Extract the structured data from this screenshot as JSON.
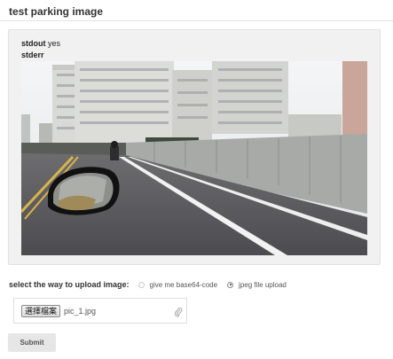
{
  "page": {
    "title": "test parking image"
  },
  "output": {
    "stdout_label": "stdout",
    "stdout_value": "yes",
    "stderr_label": "stderr",
    "stderr_value": ""
  },
  "upload": {
    "label": "select the way to upload image:",
    "options": [
      {
        "label": "give me base64-code",
        "checked": false
      },
      {
        "label": "jpeg file upload",
        "checked": true
      }
    ],
    "file_button": "選擇檔案",
    "file_name": "pic_1.jpg",
    "attach_icon": "paperclip-icon"
  },
  "form": {
    "submit_label": "Submit"
  }
}
